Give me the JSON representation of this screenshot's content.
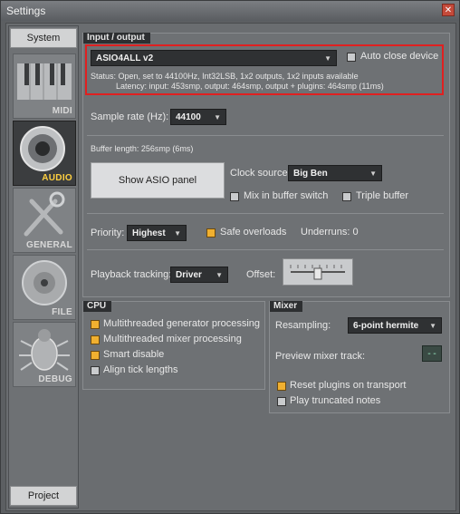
{
  "window": {
    "title": "Settings",
    "close_icon": "close-icon"
  },
  "sidebar": {
    "top_tab": "System",
    "bottom_tab": "Project",
    "items": [
      {
        "label": "MIDI",
        "icon": "piano-keys-icon"
      },
      {
        "label": "AUDIO",
        "icon": "speaker-icon",
        "active": true
      },
      {
        "label": "GENERAL",
        "icon": "tools-icon"
      },
      {
        "label": "FILE",
        "icon": "disc-icon"
      },
      {
        "label": "DEBUG",
        "icon": "bug-icon"
      }
    ]
  },
  "input_output": {
    "header": "Input / output",
    "device": "ASIO4ALL v2",
    "auto_close_label": "Auto close device",
    "status_line": "Status: Open, set to 44100Hz, Int32LSB, 1x2 outputs, 1x2 inputs available",
    "latency_line": "Latency: input: 453smp, output: 464smp, output + plugins: 464smp (11ms)",
    "sample_rate_label": "Sample rate (Hz):",
    "sample_rate_value": "44100",
    "buffer_length": "Buffer length: 256smp (6ms)",
    "show_asio_button": "Show ASIO panel",
    "clock_source_label": "Clock source:",
    "clock_source_value": "Big Ben",
    "mix_in_buffer_label": "Mix in buffer switch",
    "triple_buffer_label": "Triple buffer",
    "priority_label": "Priority:",
    "priority_value": "Highest",
    "safe_overloads_label": "Safe overloads",
    "underruns": "Underruns: 0",
    "playback_label": "Playback tracking:",
    "playback_value": "Driver",
    "offset_label": "Offset:"
  },
  "cpu": {
    "header": "CPU",
    "options": [
      {
        "label": "Multithreaded generator processing",
        "checked": true
      },
      {
        "label": "Multithreaded mixer processing",
        "checked": true
      },
      {
        "label": "Smart disable",
        "checked": true
      },
      {
        "label": "Align tick lengths",
        "checked": false
      }
    ]
  },
  "mixer": {
    "header": "Mixer",
    "resampling_label": "Resampling:",
    "resampling_value": "6-point hermite",
    "preview_label": "Preview mixer track:",
    "preview_value": "--",
    "reset_plugins_label": "Reset plugins on transport",
    "truncated_notes_label": "Play truncated notes"
  },
  "colors": {
    "accent": "#f0b030",
    "highlight": "#e02020",
    "background": "#6e7174"
  }
}
